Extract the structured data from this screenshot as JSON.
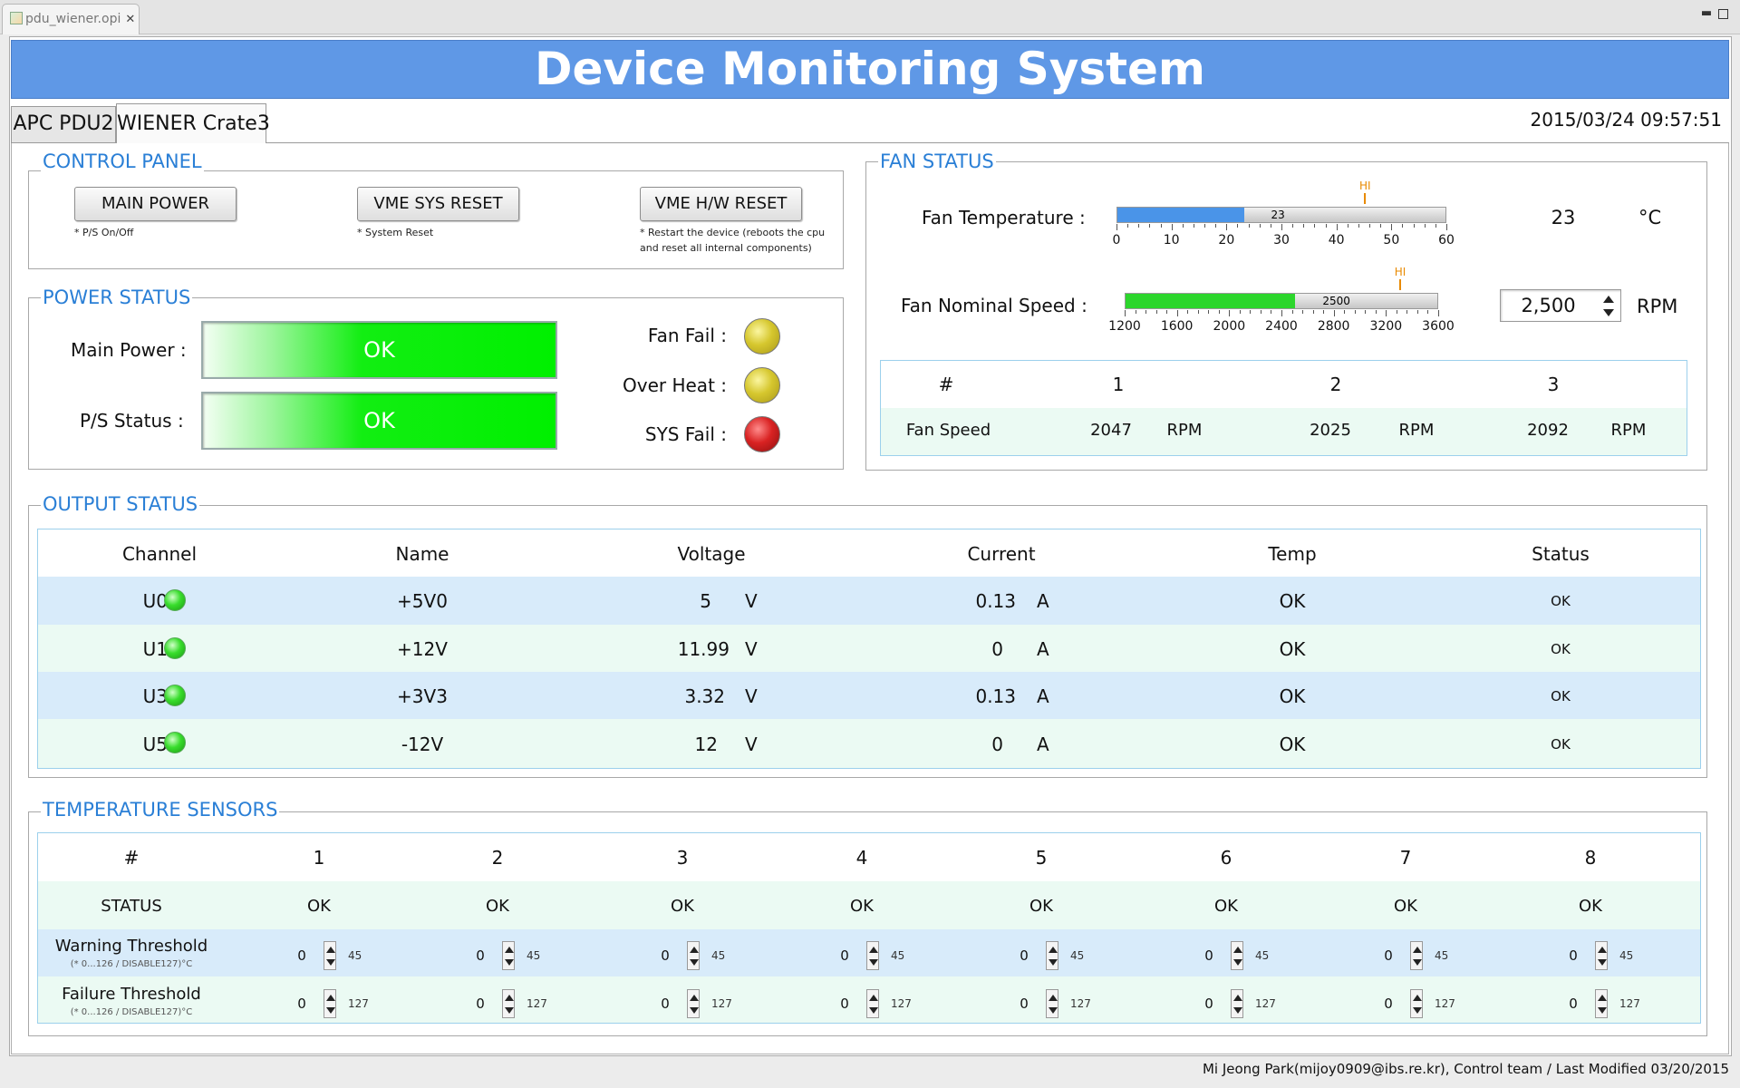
{
  "editor_tab": {
    "label": "pdu_wiener.opi"
  },
  "banner": {
    "title": "Device Monitoring System"
  },
  "device_tabs": [
    {
      "label": "APC PDU2"
    },
    {
      "label": "WIENER Crate3"
    }
  ],
  "datetime": "2015/03/24 09:57:51",
  "control_panel": {
    "title": "CONTROL PANEL",
    "buttons": [
      {
        "label": "MAIN POWER",
        "note": "* P/S On/Off"
      },
      {
        "label": "VME SYS RESET",
        "note": "* System Reset"
      },
      {
        "label": "VME H/W RESET",
        "note_line1": "* Restart the device (reboots the cpu",
        "note_line2": "and reset all internal components)"
      }
    ]
  },
  "power_status": {
    "title": "POWER STATUS",
    "main_power": {
      "label": "Main Power :",
      "value": "OK"
    },
    "ps_status": {
      "label": "P/S Status :",
      "value": "OK"
    },
    "indicators": [
      {
        "label": "Fan Fail :",
        "color": "#d6c72e"
      },
      {
        "label": "Over Heat :",
        "color": "#d6c72e"
      },
      {
        "label": "SYS Fail :",
        "color": "#d92222"
      }
    ]
  },
  "fan_status": {
    "title": "FAN STATUS",
    "temperature": {
      "label": "Fan Temperature :",
      "value": 23,
      "value_text": "23",
      "min": 0,
      "max": 60,
      "hi": 45,
      "hi_label": "HI",
      "ticks": [
        "0",
        "10",
        "20",
        "30",
        "40",
        "50",
        "60"
      ],
      "display": "23",
      "unit": "°C",
      "fill_color": "#4a94e8"
    },
    "nominal_speed": {
      "label": "Fan Nominal Speed :",
      "value": 2500,
      "value_text": "2500",
      "min": 1200,
      "max": 3600,
      "hi": 3300,
      "hi_label": "HI",
      "ticks": [
        "1200",
        "1600",
        "2000",
        "2400",
        "2800",
        "3200",
        "3600"
      ],
      "input_value": "2,500",
      "unit": "RPM",
      "fill_color": "#2cd62c"
    },
    "table": {
      "header": [
        "#",
        "1",
        "2",
        "3"
      ],
      "row_label": "Fan Speed",
      "speeds": [
        {
          "value": "2047",
          "unit": "RPM"
        },
        {
          "value": "2025",
          "unit": "RPM"
        },
        {
          "value": "2092",
          "unit": "RPM"
        }
      ]
    }
  },
  "output_status": {
    "title": "OUTPUT STATUS",
    "columns": [
      "Channel",
      "Name",
      "Voltage",
      "Current",
      "Temp",
      "Status"
    ],
    "rows": [
      {
        "channel": "U0",
        "name": "+5V0",
        "voltage": "5",
        "v_unit": "V",
        "current": "0.13",
        "a_unit": "A",
        "temp": "OK",
        "status": "OK"
      },
      {
        "channel": "U1",
        "name": "+12V",
        "voltage": "11.99",
        "v_unit": "V",
        "current": "0",
        "a_unit": "A",
        "temp": "OK",
        "status": "OK"
      },
      {
        "channel": "U3",
        "name": "+3V3",
        "voltage": "3.32",
        "v_unit": "V",
        "current": "0.13",
        "a_unit": "A",
        "temp": "OK",
        "status": "OK"
      },
      {
        "channel": "U5",
        "name": "-12V",
        "voltage": "12",
        "v_unit": "V",
        "current": "0",
        "a_unit": "A",
        "temp": "OK",
        "status": "OK"
      }
    ]
  },
  "temperature_sensors": {
    "title": "TEMPERATURE SENSORS",
    "header_hash": "#",
    "sensors": [
      "1",
      "2",
      "3",
      "4",
      "5",
      "6",
      "7",
      "8"
    ],
    "status_label": "STATUS",
    "status_values": [
      "OK",
      "OK",
      "OK",
      "OK",
      "OK",
      "OK",
      "OK",
      "OK"
    ],
    "warning": {
      "label": "Warning Threshold",
      "sub": "(* 0...126 / DISABLE127)°C",
      "input": "0",
      "value": "45"
    },
    "failure": {
      "label": "Failure Threshold",
      "sub": "(* 0...126 / DISABLE127)°C",
      "input": "0",
      "value": "127"
    }
  },
  "footer": "Mi Jeong Park(mijoy0909@ibs.re.kr), Control team / Last Modified 03/20/2015"
}
